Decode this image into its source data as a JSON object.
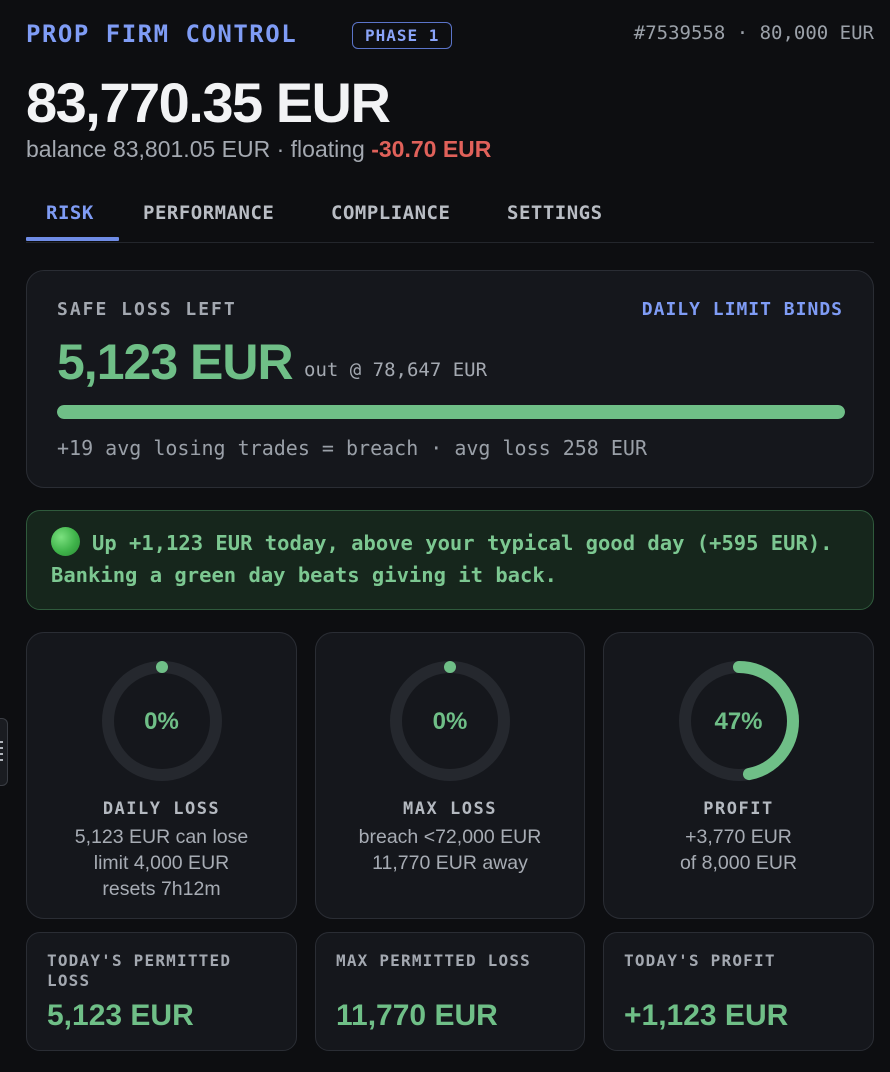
{
  "header": {
    "app_title": "PROP FIRM CONTROL",
    "phase": "PHASE 1",
    "account_meta": "#7539558 · 80,000 EUR"
  },
  "equity": "83,770.35 EUR",
  "balance_line": {
    "prefix": "balance 83,801.05 EUR · floating ",
    "floating": "-30.70 EUR"
  },
  "tabs": [
    {
      "label": "RISK",
      "active": true
    },
    {
      "label": "PERFORMANCE",
      "active": false
    },
    {
      "label": "COMPLIANCE",
      "active": false
    },
    {
      "label": "SETTINGS",
      "active": false
    }
  ],
  "safe_loss": {
    "label": "SAFE LOSS LEFT",
    "status": "DAILY LIMIT BINDS",
    "amount": "5,123 EUR",
    "out_at": "out @ 78,647 EUR",
    "progress": 1.0,
    "note": "+19 avg losing trades = breach · avg loss 258 EUR"
  },
  "alert": {
    "icon": "green-circle",
    "text": "Up +1,123 EUR today, above your typical good day (+595 EUR). Banking a green day beats giving it back."
  },
  "gauges": [
    {
      "value": "0%",
      "fraction": 0.0,
      "title": "DAILY LOSS",
      "lines": [
        "5,123 EUR can lose",
        "limit 4,000 EUR",
        "resets 7h12m"
      ]
    },
    {
      "value": "0%",
      "fraction": 0.0,
      "title": "MAX LOSS",
      "lines": [
        "breach <72,000 EUR",
        "11,770 EUR away",
        ""
      ]
    },
    {
      "value": "47%",
      "fraction": 0.47,
      "title": "PROFIT",
      "lines": [
        "+3,770 EUR",
        "of 8,000 EUR",
        ""
      ]
    }
  ],
  "stats": [
    {
      "label": "TODAY'S PERMITTED LOSS",
      "value": "5,123 EUR"
    },
    {
      "label": "MAX PERMITTED LOSS",
      "value": "11,770 EUR"
    },
    {
      "label": "TODAY'S PROFIT",
      "value": "+1,123 EUR"
    }
  ],
  "colors": {
    "accent": "#7f9cf5",
    "positive": "#6fbf87",
    "negative": "#e0615a",
    "background": "#0d0e11",
    "card": "#15171c"
  }
}
